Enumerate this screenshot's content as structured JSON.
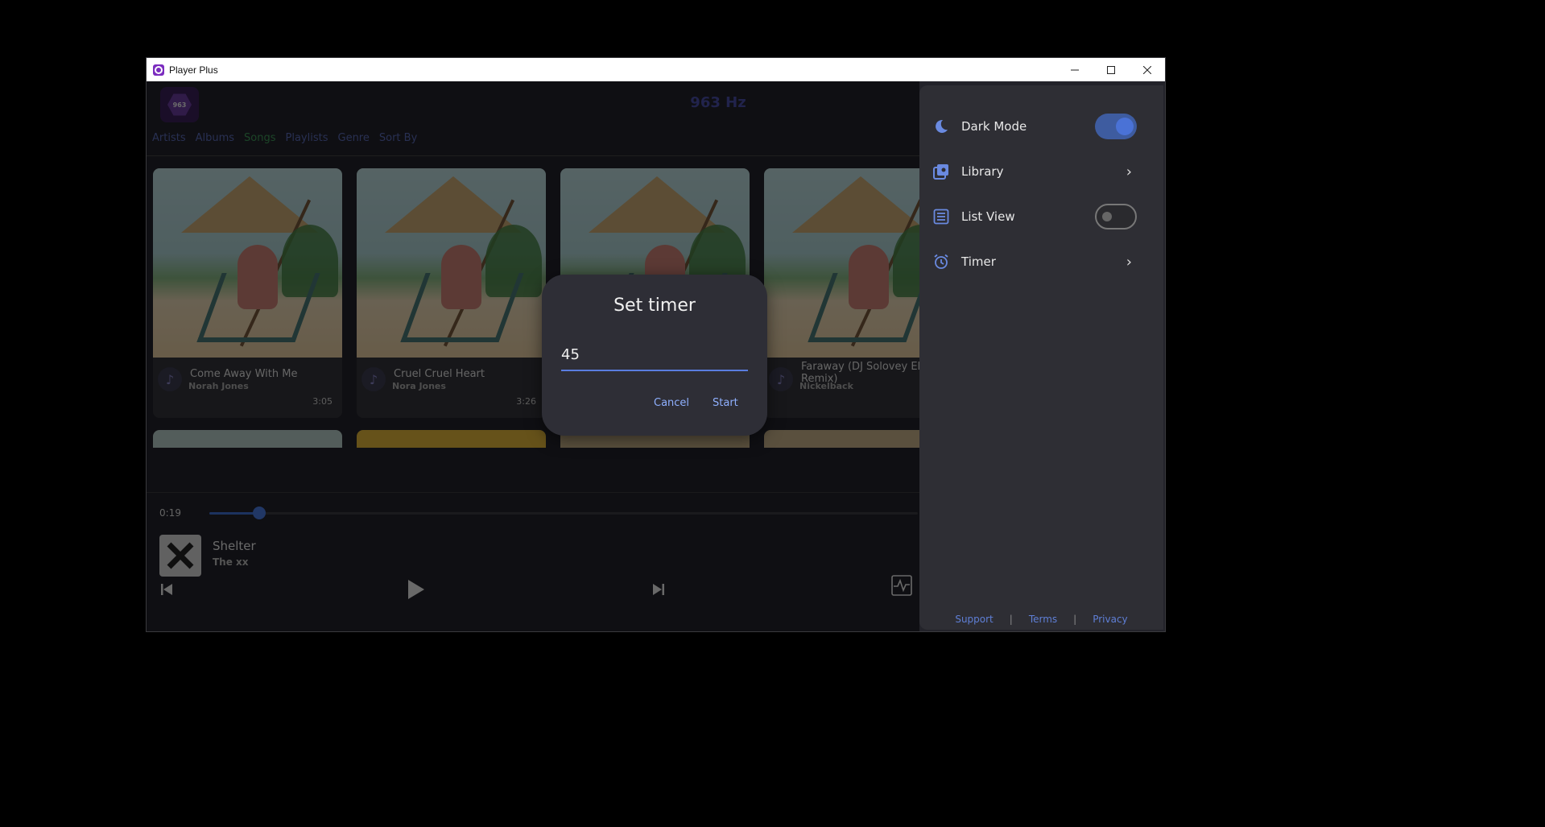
{
  "window": {
    "title": "Player Plus"
  },
  "header": {
    "logo_text": "963",
    "title": "963 Hz"
  },
  "nav": {
    "tabs": [
      "Artists",
      "Albums",
      "Songs",
      "Playlists",
      "Genre",
      "Sort By"
    ],
    "active": "Songs"
  },
  "songs": [
    {
      "title": "Come Away With Me",
      "artist": "Norah Jones",
      "duration": "3:05"
    },
    {
      "title": "Cruel Cruel Heart",
      "artist": "Nora Jones",
      "duration": "3:26"
    },
    {
      "title": "",
      "artist": "",
      "duration": ""
    },
    {
      "title": "Faraway (DJ Solovey Ele Remix)",
      "artist": "Nickelback",
      "duration": ""
    }
  ],
  "player": {
    "elapsed": "0:19",
    "progress_fraction": 0.07,
    "now_playing_title": "Shelter",
    "now_playing_artist": "The xx"
  },
  "settings_panel": {
    "items": [
      {
        "label": "Dark Mode",
        "icon": "moon-icon",
        "control": "toggle",
        "on": true
      },
      {
        "label": "Library",
        "icon": "library-icon",
        "control": "chevron"
      },
      {
        "label": "List View",
        "icon": "list-icon",
        "control": "toggle",
        "on": false
      },
      {
        "label": "Timer",
        "icon": "alarm-clock-icon",
        "control": "chevron"
      }
    ],
    "footer": {
      "support": "Support",
      "terms": "Terms",
      "privacy": "Privacy",
      "separator": "|"
    }
  },
  "dialog": {
    "title": "Set timer",
    "input_value": "45",
    "cancel": "Cancel",
    "start": "Start"
  },
  "colors": {
    "accent": "#4a72d6",
    "active_tab": "#3e9a5a",
    "brand": "#7b2cbf"
  }
}
